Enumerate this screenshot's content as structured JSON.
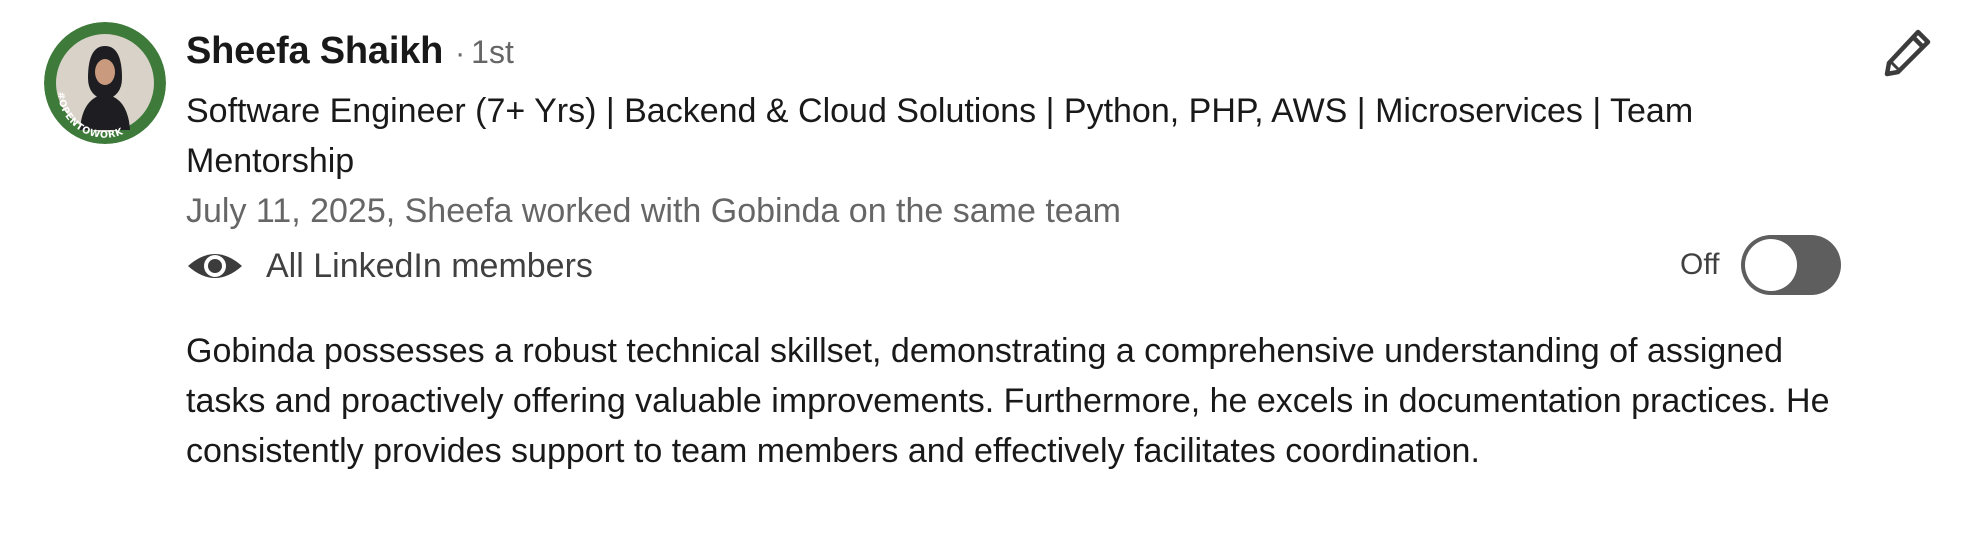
{
  "recommendation": {
    "recommender": {
      "name": "Sheefa Shaikh",
      "separator": "·",
      "degree": "1st",
      "avatar_badge_text": "#OPENTOWORK",
      "headline": "Software Engineer (7+ Yrs) | Backend & Cloud Solutions | Python, PHP, AWS | Microservices | Team Mentorship"
    },
    "meta": "July 11, 2025, Sheefa worked with Gobinda on the same team",
    "visibility": {
      "icon": "eye-icon",
      "label": "All LinkedIn members"
    },
    "toggle": {
      "state_label": "Off",
      "on": false
    },
    "text": "Gobinda possesses a robust technical skillset, demonstrating a comprehensive understanding of assigned tasks and proactively offering valuable improvements. Furthermore, he excels in documentation practices. He consistently provides support to team members and effectively facilitates coordination.",
    "actions": {
      "edit_icon": "pencil-icon"
    }
  },
  "colors": {
    "open_to_work_green": "#3e7a3a",
    "toggle_off_track": "#5e5e5e",
    "secondary_text": "#666666"
  }
}
